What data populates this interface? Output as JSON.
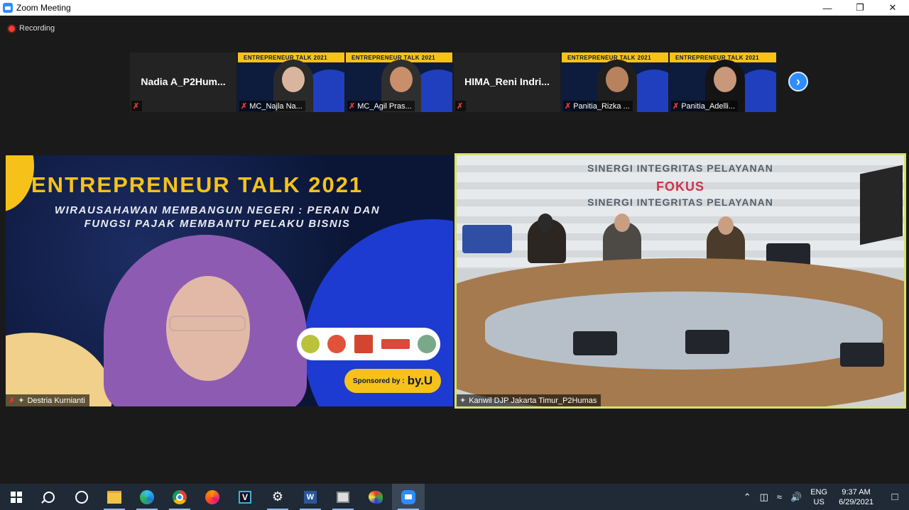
{
  "window": {
    "title": "Zoom Meeting",
    "controls": [
      "minimize",
      "restore",
      "close"
    ]
  },
  "recording": {
    "label": "Recording"
  },
  "gallery": [
    {
      "name": "Nadia  A_P2Hum...",
      "kind": "name-only",
      "muted": true
    },
    {
      "name": "MC_Najla Na...",
      "kind": "video",
      "muted": true
    },
    {
      "name": "MC_Agil Pras...",
      "kind": "video",
      "muted": true
    },
    {
      "name": "HIMA_Reni  Indri...",
      "kind": "name-only",
      "muted": true
    },
    {
      "name": "Panitia_Rizka ...",
      "kind": "video",
      "muted": true
    },
    {
      "name": "Panitia_Adelli...",
      "kind": "video",
      "muted": true
    }
  ],
  "thumb_banner": "ENTREPRENEUR TALK 2021",
  "main": {
    "left": {
      "name": "Destria Kurnianti",
      "banner_title": "ENTREPRENEUR TALK 2021",
      "banner_subtitle": "WIRAUSAHAWAN MEMBANGUN NEGERI : PERAN DAN FUNGSI PAJAK MEMBANTU PELAKU BISNIS",
      "sponsor_label": "Sponsored by :",
      "sponsor_brand": "by.U"
    },
    "right": {
      "name": "Kanwil DJP Jakarta Timur_P2Humas",
      "wall_lines": [
        "SINERGI INTEGRITAS PELAYANAN",
        "SINERGI  FOKUS  PELAYANAN",
        "SINERGI INTEGRITAS PELAYANAN"
      ],
      "highlight_word": "FOKUS"
    }
  },
  "taskbar": {
    "apps": [
      "windows-start",
      "search",
      "cortana",
      "file-explorer",
      "edge",
      "chrome",
      "firefox",
      "vscode-like",
      "settings",
      "word",
      "network-app",
      "paint",
      "zoom"
    ],
    "tray": {
      "lang_top": "ENG",
      "lang_bottom": "US",
      "time": "9:37 AM",
      "date": "6/29/2021"
    }
  },
  "colors": {
    "accent": "#2d8cff",
    "active_speaker_border": "#d6e36a",
    "banner_yellow": "#f6c21a"
  }
}
